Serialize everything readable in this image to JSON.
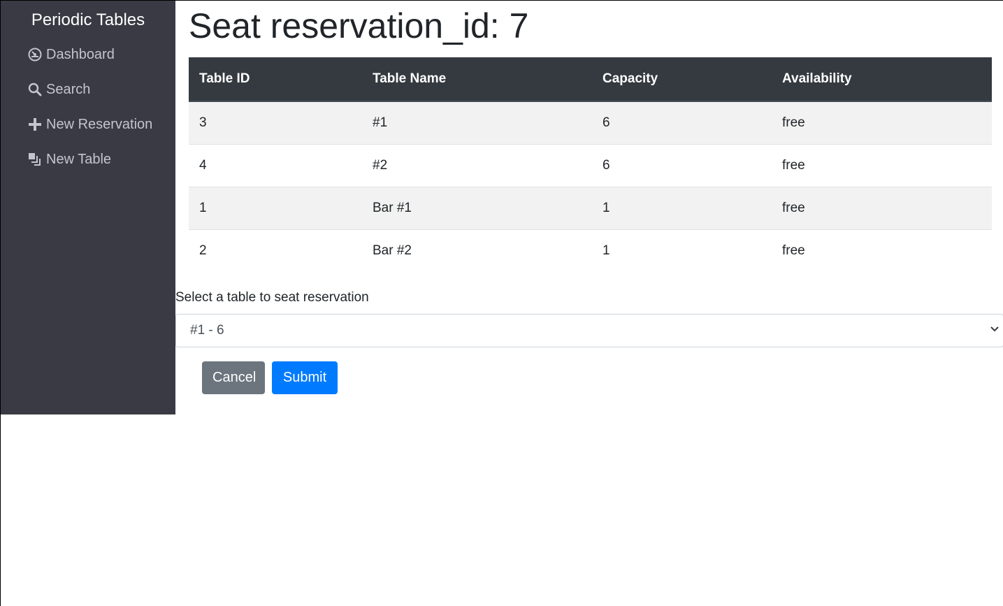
{
  "sidebar": {
    "brand": "Periodic Tables",
    "items": [
      {
        "label": "Dashboard",
        "icon": "dashboard-icon"
      },
      {
        "label": "Search",
        "icon": "search-icon"
      },
      {
        "label": "New Reservation",
        "icon": "plus-icon"
      },
      {
        "label": "New Table",
        "icon": "layers-icon"
      }
    ]
  },
  "main": {
    "title": "Seat reservation_id: 7",
    "table": {
      "headers": [
        "Table ID",
        "Table Name",
        "Capacity",
        "Availability"
      ],
      "rows": [
        [
          "3",
          "#1",
          "6",
          "free"
        ],
        [
          "4",
          "#2",
          "6",
          "free"
        ],
        [
          "1",
          "Bar #1",
          "1",
          "free"
        ],
        [
          "2",
          "Bar #2",
          "1",
          "free"
        ]
      ]
    },
    "form": {
      "label": "Select a table to seat reservation",
      "selected": "#1 - 6"
    },
    "buttons": {
      "cancel": "Cancel",
      "submit": "Submit"
    }
  },
  "colors": {
    "sidebar_bg": "#393a44",
    "table_header_bg": "#343a40",
    "cancel_bg": "#6c757d",
    "submit_bg": "#007bff"
  }
}
